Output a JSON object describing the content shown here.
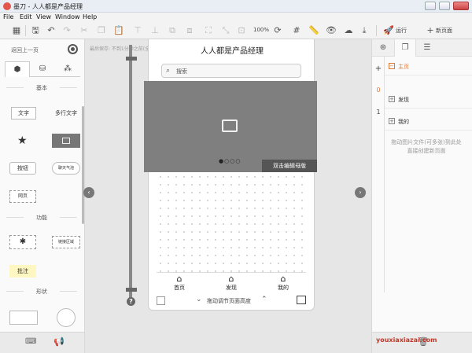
{
  "window": {
    "title": "墨刀 - 人人都是产品经理"
  },
  "menu": [
    "File",
    "Edit",
    "View",
    "Window",
    "Help"
  ],
  "toolbar": {
    "zoom": "100%",
    "run_label": "运行",
    "new_page_label": "新页面"
  },
  "left_panel": {
    "back_label": "返回上一页",
    "sections": {
      "basic": "基本",
      "function": "功能",
      "shape": "形状"
    },
    "widgets": {
      "text": "文字",
      "multiline": "多行文字",
      "button": "按钮",
      "bubble": "聊天气泡",
      "webpage": "网页",
      "gesture": "链接区域",
      "annotation": "批注"
    }
  },
  "canvas": {
    "autosave_text": "最后保存: 不到1分钟之前(全部操作已保存)",
    "page_title": "人人都是产品经理",
    "search_placeholder": "搜索",
    "carousel_dots": "●○○○",
    "carousel_edit": "双击编辑母版",
    "tabs": [
      "首页",
      "发现",
      "我的"
    ],
    "bottom_hint": "拖动调节页面高度"
  },
  "right_panel": {
    "side_numbers": [
      "0",
      "1"
    ],
    "pages": [
      "主页",
      "发现",
      "我的"
    ],
    "hint_line1": "拖动图片文件(可多张)到此处",
    "hint_line2": "直接创建新页面"
  },
  "watermark": "youxiaxiazai.com",
  "colors": {
    "accent": "#e07a3a",
    "carousel": "#7f7f7f",
    "watermark": "#c03a2b"
  }
}
